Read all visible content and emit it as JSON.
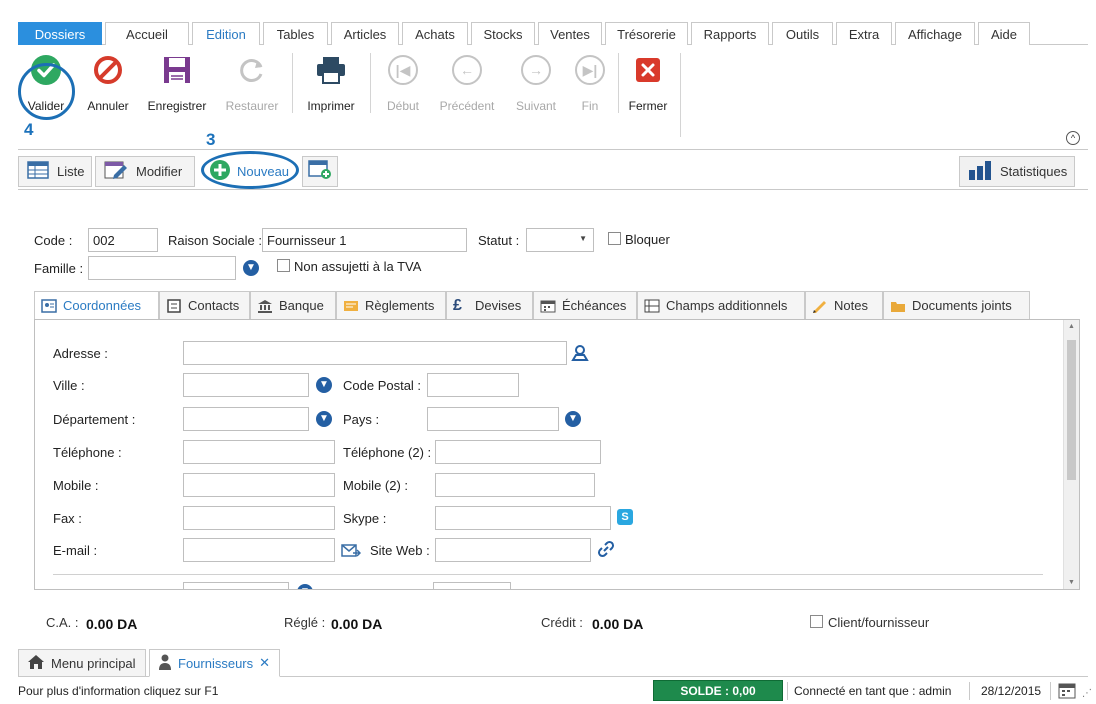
{
  "menu": {
    "tabs": [
      "Dossiers",
      "Accueil",
      "Edition",
      "Tables",
      "Articles",
      "Achats",
      "Stocks",
      "Ventes",
      "Trésorerie",
      "Rapports",
      "Outils",
      "Extra",
      "Affichage",
      "Aide"
    ],
    "active": "Edition"
  },
  "ribbon": {
    "valider": "Valider",
    "annuler": "Annuler",
    "enregistrer": "Enregistrer",
    "restaurer": "Restaurer",
    "imprimer": "Imprimer",
    "debut": "Début",
    "precedent": "Précédent",
    "suivant": "Suivant",
    "fin": "Fin",
    "fermer": "Fermer"
  },
  "annotations": {
    "step3": "3",
    "step4": "4"
  },
  "subbar": {
    "liste": "Liste",
    "modifier": "Modifier",
    "nouveau": "Nouveau",
    "statistiques": "Statistiques"
  },
  "form": {
    "code_label": "Code :",
    "code_value": "002",
    "raison_label": "Raison Sociale :",
    "raison_value": "Fournisseur 1",
    "statut_label": "Statut :",
    "statut_value": "",
    "bloquer_label": "Bloquer",
    "famille_label": "Famille :",
    "famille_value": "",
    "tva_label": "Non assujetti à la TVA"
  },
  "inner_tabs": [
    "Coordonnées",
    "Contacts",
    "Banque",
    "Règlements",
    "Devises",
    "Échéances",
    "Champs additionnels",
    "Notes",
    "Documents joints"
  ],
  "coords": {
    "adresse": "Adresse :",
    "ville": "Ville :",
    "code_postal": "Code Postal :",
    "departement": "Département :",
    "pays": "Pays :",
    "telephone": "Téléphone :",
    "telephone2": "Téléphone (2) :",
    "mobile": "Mobile :",
    "mobile2": "Mobile (2) :",
    "fax": "Fax :",
    "skype": "Skype :",
    "email": "E-mail :",
    "siteweb": "Site Web :"
  },
  "summary": {
    "ca_label": "C.A. :",
    "ca_value": "0.00 DA",
    "regle_label": "Réglé :",
    "regle_value": "0.00 DA",
    "credit_label": "Crédit :",
    "credit_value": "0.00 DA",
    "client_fournisseur": "Client/fournisseur"
  },
  "doc_tabs": {
    "menu_principal": "Menu principal",
    "fournisseurs": "Fournisseurs"
  },
  "status": {
    "help": "Pour plus d'information cliquez sur F1",
    "solde": "SOLDE : 0,00",
    "connected": "Connecté en tant que : admin",
    "date": "28/12/2015"
  },
  "colors": {
    "accent": "#2b8fde",
    "annotation": "#1c6fb5",
    "solde_bg": "#1e8a4c",
    "valider": "#2ea861",
    "annuler": "#d63b2b",
    "fermer": "#d93a2b"
  }
}
